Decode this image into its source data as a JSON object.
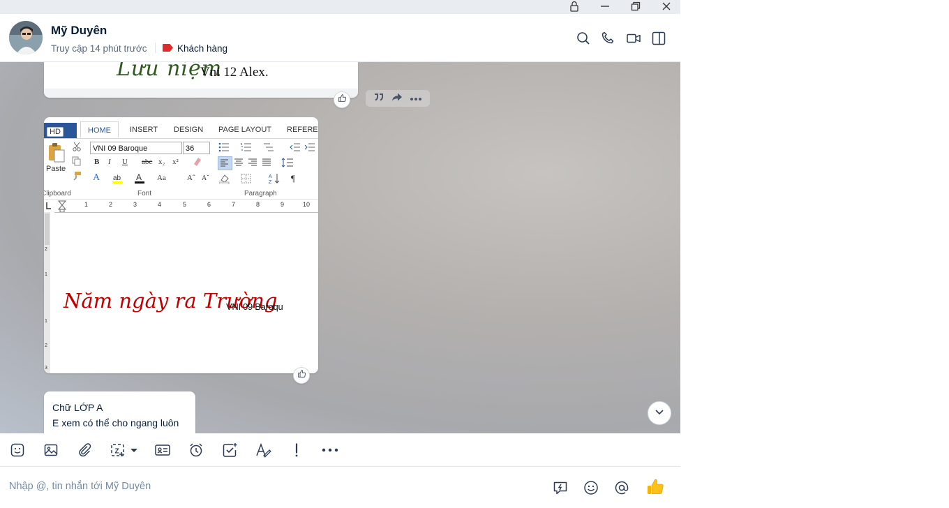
{
  "window": {
    "controls": [
      "lock-icon",
      "minimize-icon",
      "restore-icon",
      "close-icon"
    ]
  },
  "header": {
    "name": "Mỹ Duyên",
    "last_seen": "Truy cập 14 phút trước",
    "tag_label": "Khách hàng",
    "tag_color": "#e02b2b",
    "actions": [
      "search-icon",
      "phone-icon",
      "video-icon",
      "sidebar-toggle-icon"
    ]
  },
  "messages": {
    "font_sample_1": {
      "cursive_text": "Lưu niệm",
      "font_name": "Vni 12 Alex."
    },
    "hover_actions": [
      "quote-icon",
      "forward-icon",
      "more-icon"
    ],
    "image_message": {
      "hd_badge": "HD",
      "tabs": [
        "HOME",
        "INSERT",
        "DESIGN",
        "PAGE LAYOUT",
        "REFEREN"
      ],
      "font_name_box": "VNI 09 Baroque",
      "font_size_box": "36",
      "paste_label": "Paste",
      "group_clipboard": "Clipboard",
      "group_font": "Font",
      "group_paragraph": "Paragraph",
      "ruler_numbers": [
        "1",
        "2",
        "3",
        "4",
        "5",
        "6",
        "7",
        "8",
        "9",
        "10"
      ],
      "vruler_numbers": [
        "2",
        "1",
        "1",
        "2",
        "3"
      ],
      "doc_cursive_text": "Năm ngày ra Trường",
      "doc_font_label": "VNI 09 Baroqu"
    },
    "text_message": {
      "line1": "Chữ LỚP A",
      "line2": "E xem có thể cho ngang luôn"
    }
  },
  "toolbar": {
    "items": [
      "sticker-icon",
      "image-icon",
      "attachment-icon",
      "screenshot-icon",
      "contact-card-icon",
      "reminder-icon",
      "task-icon",
      "text-format-icon",
      "important-icon",
      "more-icon"
    ]
  },
  "composer": {
    "placeholder": "Nhập @, tin nhắn tới Mỹ Duyên",
    "icons": [
      "quick-message-icon",
      "emoji-icon",
      "mention-icon",
      "thumbs-up-icon"
    ],
    "accent": "#0068ff"
  }
}
